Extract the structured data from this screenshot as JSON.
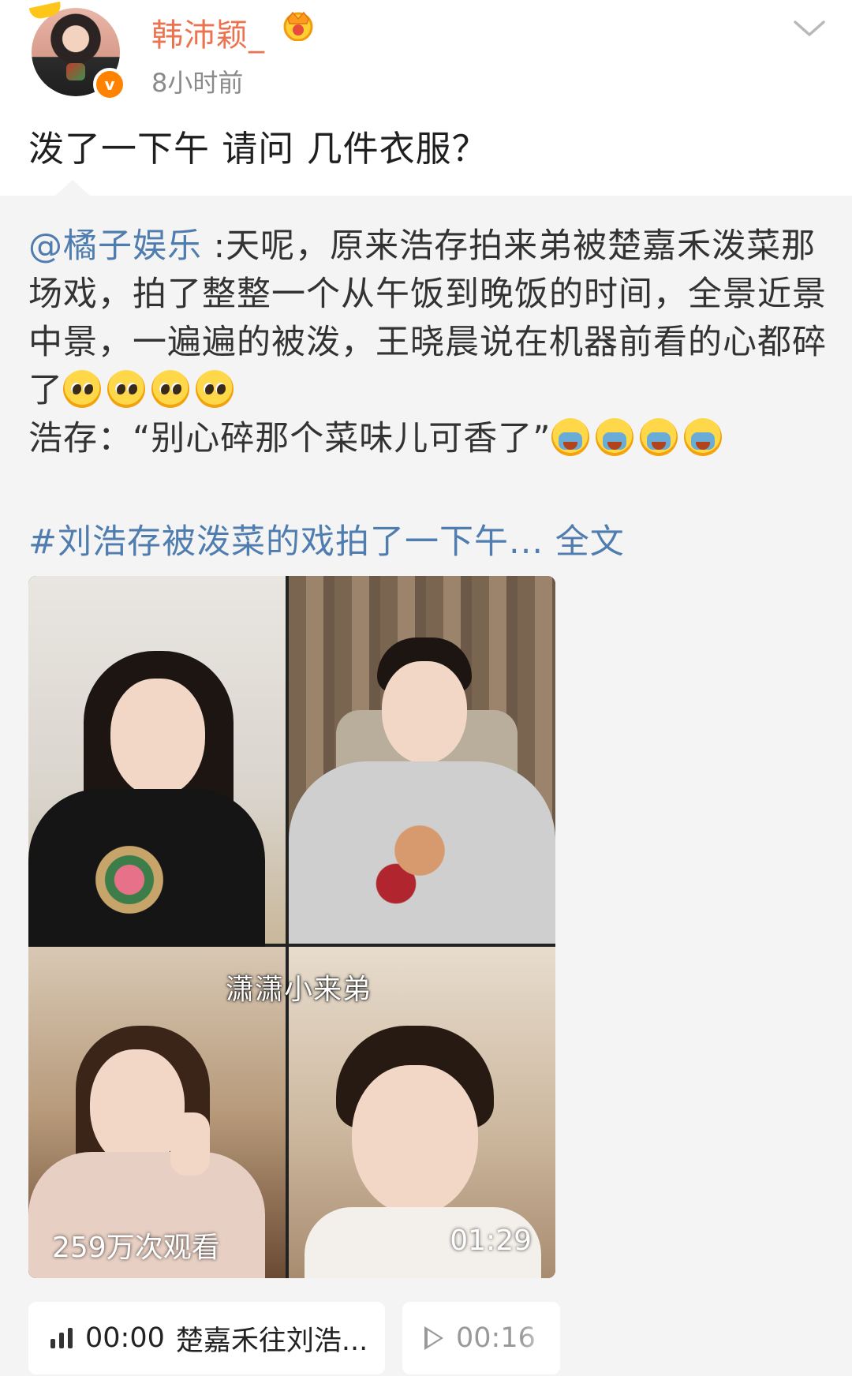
{
  "post": {
    "username": "韩沛颖_",
    "timestamp": "8小时前",
    "verified_badge": "v",
    "text": "泼了一下午 请问 几件衣服？",
    "icons": {
      "vip": "crown-icon",
      "menu": "chevron-down-icon",
      "verified": "verified-icon"
    }
  },
  "retweet": {
    "mention": "@橘子娱乐",
    "body_1": " :天呢，原来浩存拍来弟被楚嘉禾泼菜那场戏，拍了整整一个从午饭到晚饭的时间，全景近景中景，一遍遍的被泼，王晓晨说在机器前看的心都碎了",
    "body_2": "浩存：“别心碎那个菜味儿可香了”",
    "emoji_pleading_count": 4,
    "emoji_sob_count": 4,
    "topic_link": "#刘浩存被泼菜的戏拍了一下午... 全文"
  },
  "video": {
    "caption": "潇潇小来弟",
    "views": "259万次观看",
    "duration": "01:29"
  },
  "audio": [
    {
      "time": "00:00",
      "title": "楚嘉禾往刘浩...",
      "icon": "audio-bars-icon"
    },
    {
      "time": "00:16",
      "title": "",
      "icon": "play-icon"
    }
  ],
  "colors": {
    "username": "#eb7350",
    "link": "#507daf",
    "verified": "#ff8200",
    "retweet_bg": "#f4f4f4"
  }
}
